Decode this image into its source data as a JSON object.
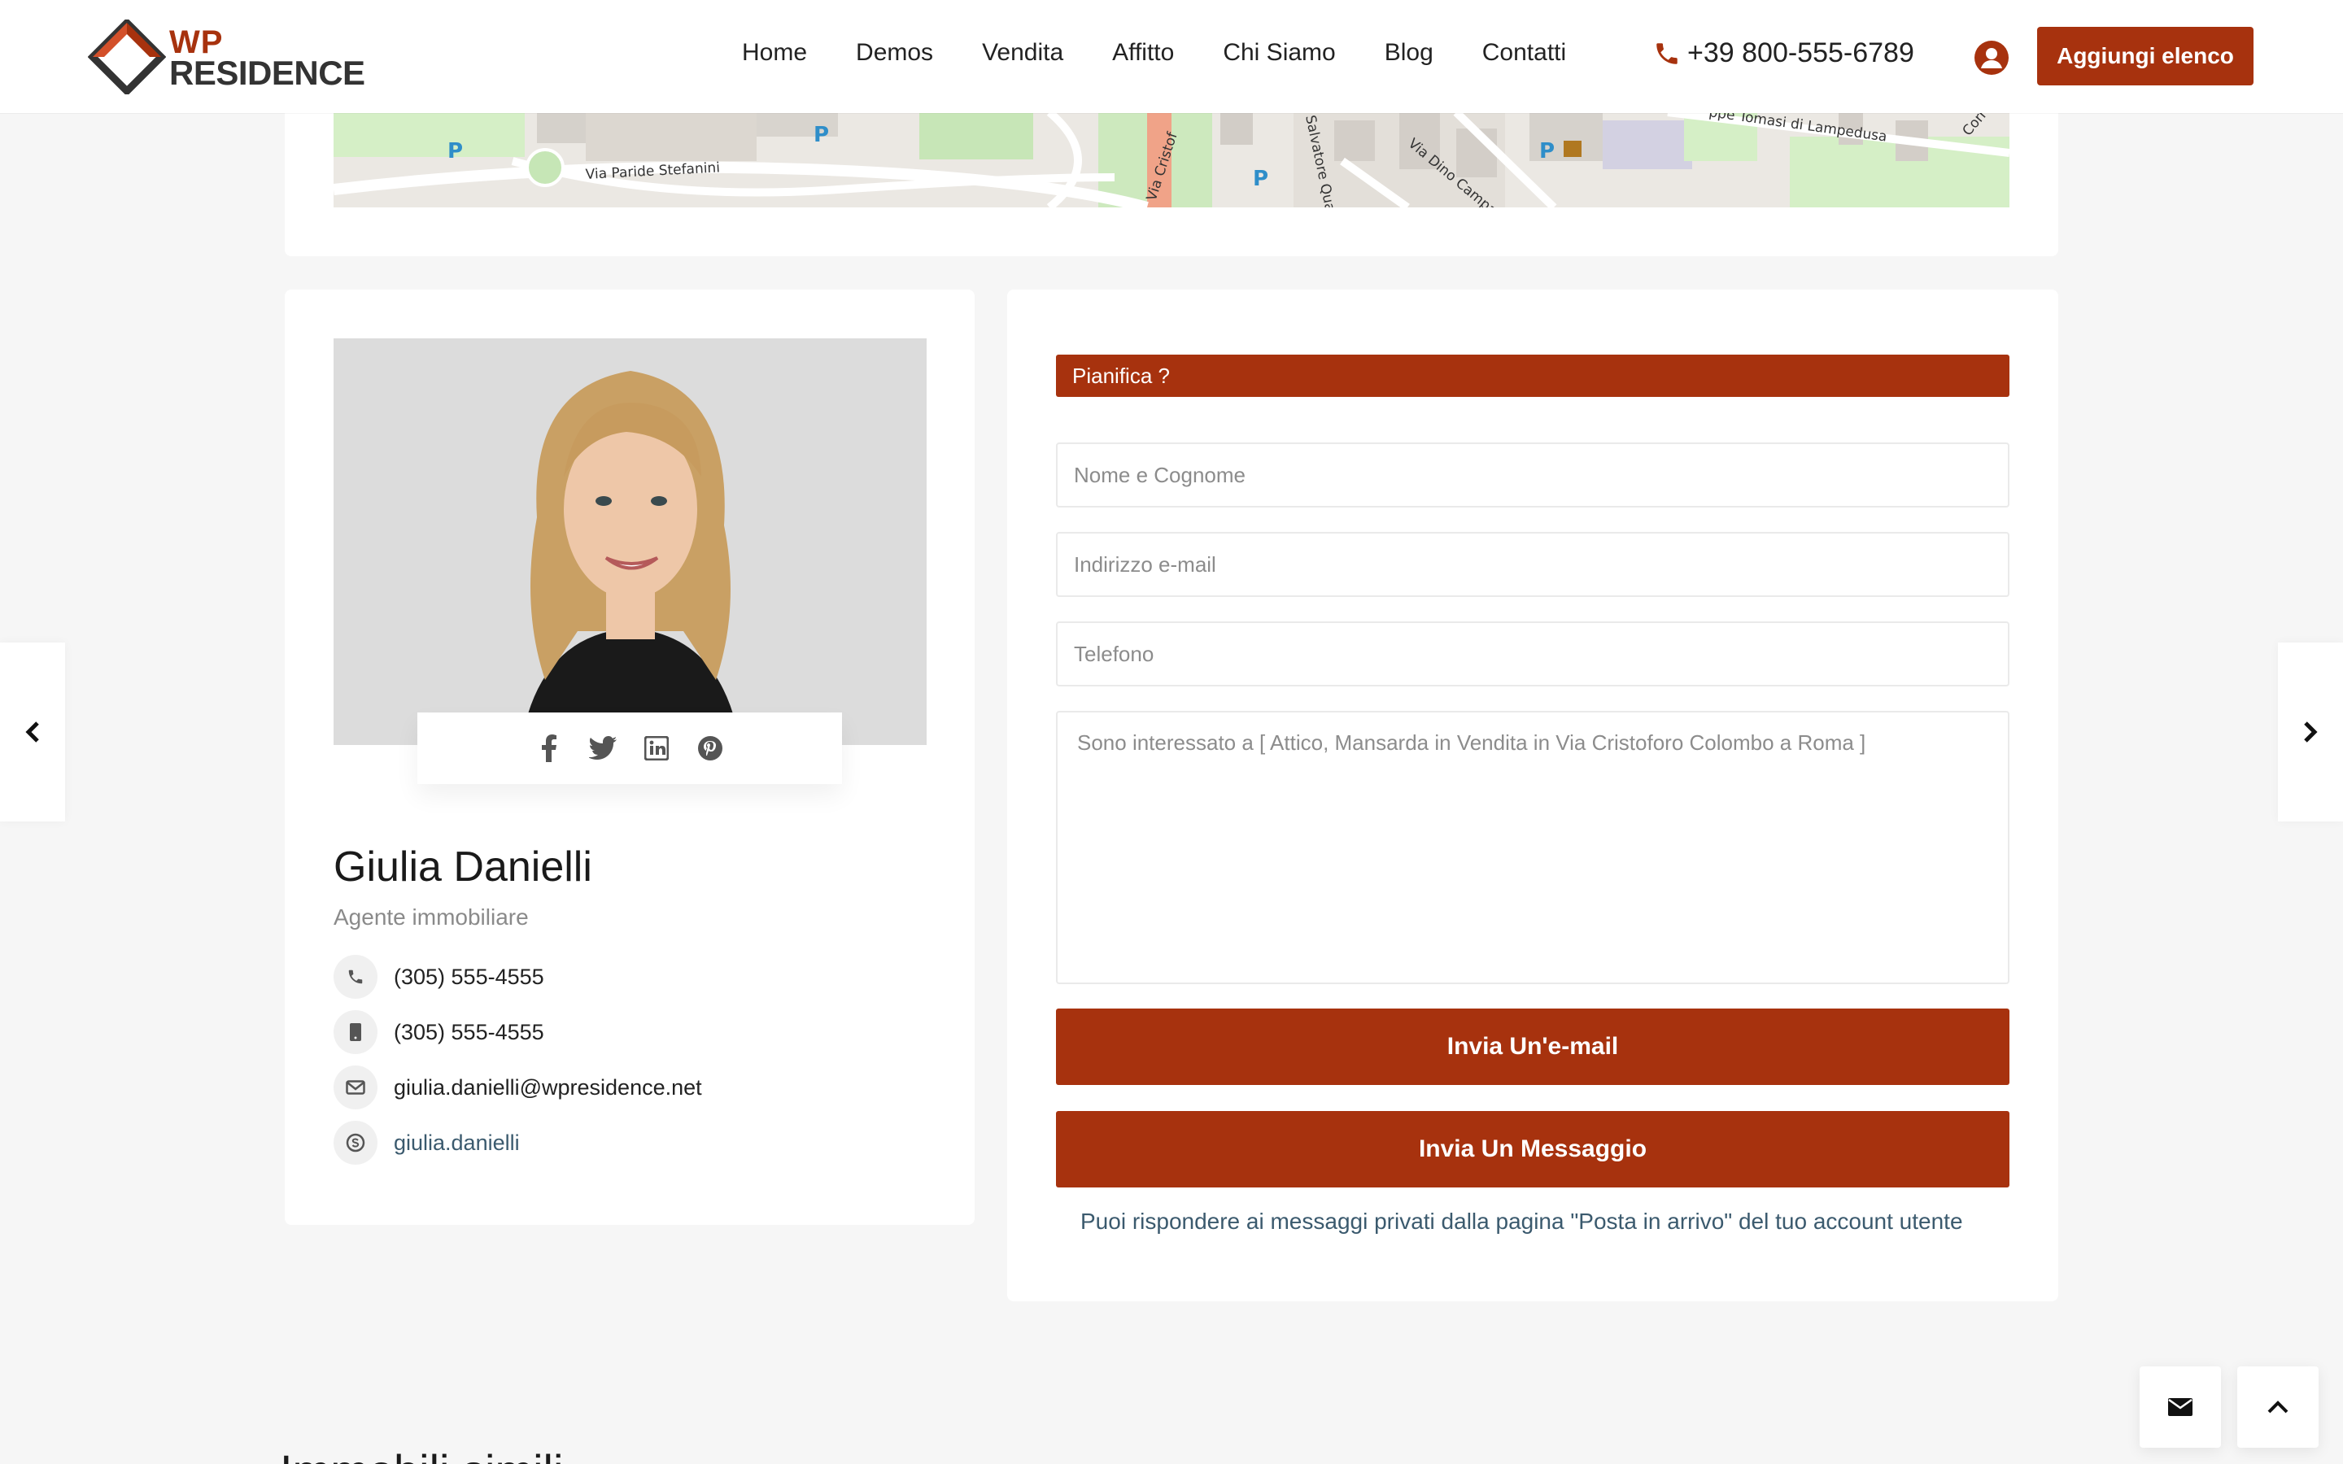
{
  "brand": {
    "logo_line1": "WP",
    "logo_line2": "RESIDENCE",
    "accent_color": "#a7320e"
  },
  "nav": {
    "items": [
      {
        "label": "Home"
      },
      {
        "label": "Demos"
      },
      {
        "label": "Vendita"
      },
      {
        "label": "Affitto"
      },
      {
        "label": "Chi Siamo"
      },
      {
        "label": "Blog"
      },
      {
        "label": "Contatti"
      }
    ],
    "phone": "+39 800-555-6789",
    "add_listing": "Aggiungi elenco"
  },
  "map": {
    "labels": [
      "Via Paride Stefanini",
      "Via Cristof",
      "Via Dino Campana",
      "Salvatore Quasim",
      "ppe Tomasi di Lampedusa",
      "Corrad"
    ]
  },
  "agent": {
    "name": "Giulia Danielli",
    "title": "Agente immobiliare",
    "social_icons": [
      "facebook-icon",
      "twitter-icon",
      "linkedin-icon",
      "pinterest-icon"
    ],
    "contacts": [
      {
        "icon": "phone-icon",
        "value": "(305) 555-4555"
      },
      {
        "icon": "mobile-icon",
        "value": "(305) 555-4555"
      },
      {
        "icon": "envelope-icon",
        "value": "giulia.danielli@wpresidence.net"
      },
      {
        "icon": "skype-icon",
        "value": "giulia.danielli"
      }
    ]
  },
  "form": {
    "schedule_label": "Pianifica ?",
    "name_placeholder": "Nome e Cognome",
    "email_placeholder": "Indirizzo e-mail",
    "phone_placeholder": "Telefono",
    "message_value": "Sono interessato a [ Attico, Mansarda in Vendita in Via Cristoforo Colombo a Roma ]",
    "send_email": "Invia Un'e-mail",
    "send_message": "Invia Un Messaggio",
    "note": "Puoi rispondere ai messaggi privati dalla pagina \"Posta in arrivo\" del tuo account utente"
  },
  "similar": {
    "heading": "Immobili simili"
  }
}
